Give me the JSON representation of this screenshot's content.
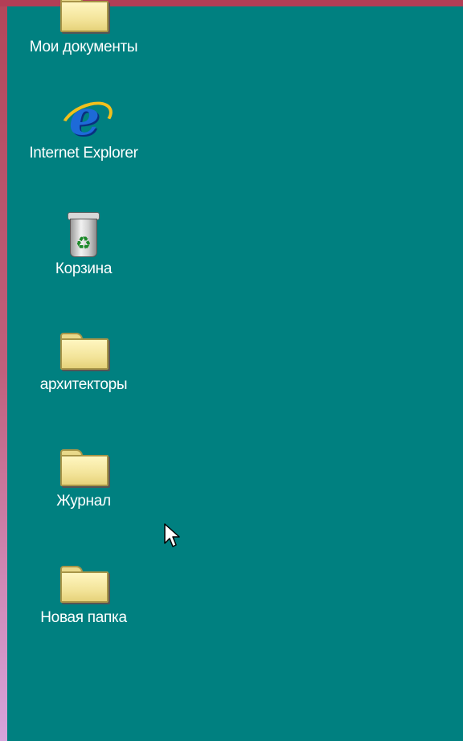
{
  "desktop": {
    "background_color": "#008080",
    "icons": [
      {
        "label": "Мои документы",
        "icon": "folder-icon"
      },
      {
        "label": "Internet Explorer",
        "icon": "internet-explorer-icon"
      },
      {
        "label": "Корзина",
        "icon": "recycle-bin-icon"
      },
      {
        "label": "архитекторы",
        "icon": "folder-icon"
      },
      {
        "label": "Журнал",
        "icon": "folder-icon"
      },
      {
        "label": "Новая папка",
        "icon": "folder-icon"
      }
    ]
  },
  "cursor": {
    "icon": "mouse-pointer-icon"
  }
}
